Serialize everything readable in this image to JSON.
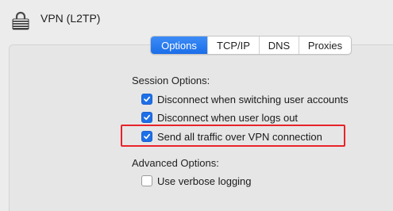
{
  "header": {
    "title": "VPN (L2TP)",
    "icon": "vpn-lock-icon"
  },
  "tabs": [
    {
      "label": "Options",
      "active": true
    },
    {
      "label": "TCP/IP",
      "active": false
    },
    {
      "label": "DNS",
      "active": false
    },
    {
      "label": "Proxies",
      "active": false
    }
  ],
  "session": {
    "label": "Session Options:",
    "options": [
      {
        "label": "Disconnect when switching user accounts",
        "checked": true
      },
      {
        "label": "Disconnect when user logs out",
        "checked": true
      },
      {
        "label": "Send all traffic over VPN connection",
        "checked": true
      }
    ]
  },
  "advanced": {
    "label": "Advanced Options:",
    "options": [
      {
        "label": "Use verbose logging",
        "checked": false
      }
    ]
  },
  "colors": {
    "accent": "#1e6fe8",
    "highlight": "#e8232a"
  }
}
